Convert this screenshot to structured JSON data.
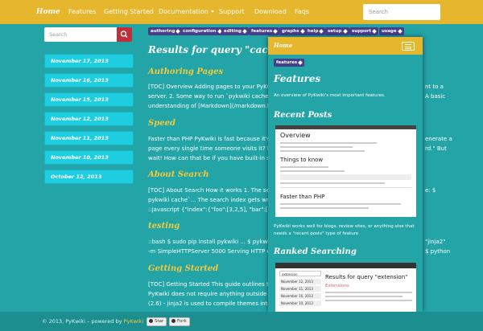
{
  "navbar": {
    "brand": "Home",
    "items": [
      "Features",
      "Getting Started",
      "Documentation",
      "Support",
      "Download",
      "Faqs"
    ],
    "search_placeholder": "Search"
  },
  "sidebar": {
    "search_placeholder": "Search",
    "search_button_icon": "search-icon",
    "dates": [
      "November 17, 2013",
      "November 16, 2013",
      "November 15, 2013",
      "November 12, 2013",
      "November 11, 2013",
      "November 10, 2013",
      "October 12, 2013"
    ]
  },
  "tags": [
    "authoring",
    "configuration",
    "editing",
    "features",
    "graphs",
    "help",
    "setup",
    "support",
    "usage"
  ],
  "main": {
    "title": "Results for query \"cach",
    "sections": [
      {
        "title": "Authoring Pages",
        "lines": [
          "[TOC] Overview Adding pages to your PyKwiki",
          "server. 2. Some way to run `pykwiki cache` to",
          "understanding of [Markdown](/markdown.ht"
        ]
      },
      {
        "title": "Speed",
        "lines": [
          "Faster than PHP PyKwiki is fast because it's 10",
          "page every single time someone visits it? PyK",
          "wait! How can that be if you have built-in sea"
        ]
      },
      {
        "title": "About Search",
        "lines": [
          "[TOC] About Search How it works 1. The searc",
          "pykwiki cache`... The search index gets written",
          "::javascript {\"index\":{\"foo\":[3,2,5], \"bar\":[3,1"
        ]
      },
      {
        "title": "testing",
        "lines": [
          "::bash $ sudo pip install pykwiki ... $ pykwiki no",
          "-m SimpleHTTPServer 5000 Serving HTTP o"
        ]
      },
      {
        "title": "Getting Started",
        "lines": [
          "[TOC] Getting Started This guide outlines the",
          "PyKwiki does not require anything outside of",
          "(2.6) - jinja2 is used to compile themes into"
        ]
      }
    ],
    "right_fragments": [
      "nt to a",
      "A basic",
      "enerate a",
      "rd.\" But",
      "e: $",
      "\"jinja2\"",
      "$ python"
    ]
  },
  "phone": {
    "brand": "Home",
    "tag": "features",
    "title": "Features",
    "intro": "An overview of PyKwiki's most important features.",
    "recent_posts_title": "Recent Posts",
    "screenshot1": {
      "heading1": "Overview",
      "heading2": "Things to know",
      "heading3": "Faster than PHP"
    },
    "caption_lines": [
      "PyKwiki works well for blogs, review sites, or anything else that",
      "needs a \"recent posts\" type of feature"
    ],
    "ranked_title": "Ranked Searching",
    "screenshot2": {
      "search_value": "extension",
      "result_title": "Results for query \"extension\"",
      "result_sub": "Extensions",
      "side_dates": [
        "November 12, 2013",
        "November 11, 2013",
        "November 10, 2013",
        "November 10, 2013"
      ]
    }
  },
  "footer": {
    "text": "© 2013, PyKwiki – powered by",
    "link": "PyKwiki",
    "star": "Star",
    "fork": "Fork"
  },
  "colors": {
    "background": "#23a4a7",
    "navbar": "#e6b62d",
    "accent_heading": "#f1c93d",
    "date_pill": "#1fcde0",
    "tag": "#46408a",
    "search_button": "#c0303a"
  }
}
